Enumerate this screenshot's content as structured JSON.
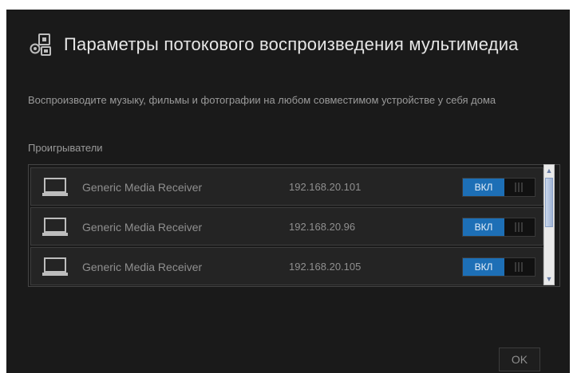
{
  "dialog": {
    "title": "Параметры потокового воспроизведения мультимедиа",
    "description": "Воспроизводите музыку, фильмы и фотографии на любом совместимом устройстве у себя дома",
    "players_label": "Проигрыватели",
    "ok_label": "OK"
  },
  "players": [
    {
      "name": "Generic Media Receiver",
      "ip": "192.168.20.101",
      "toggle_label": "ВКЛ",
      "enabled": true
    },
    {
      "name": "Generic Media Receiver",
      "ip": "192.168.20.96",
      "toggle_label": "ВКЛ",
      "enabled": true
    },
    {
      "name": "Generic Media Receiver",
      "ip": "192.168.20.105",
      "toggle_label": "ВКЛ",
      "enabled": true
    }
  ],
  "colors": {
    "background": "#1a1a1a",
    "accent": "#1d6fb6",
    "text_muted": "#8f8f8f"
  },
  "icons": {
    "header": "media-streaming-icon",
    "device": "laptop-icon"
  }
}
